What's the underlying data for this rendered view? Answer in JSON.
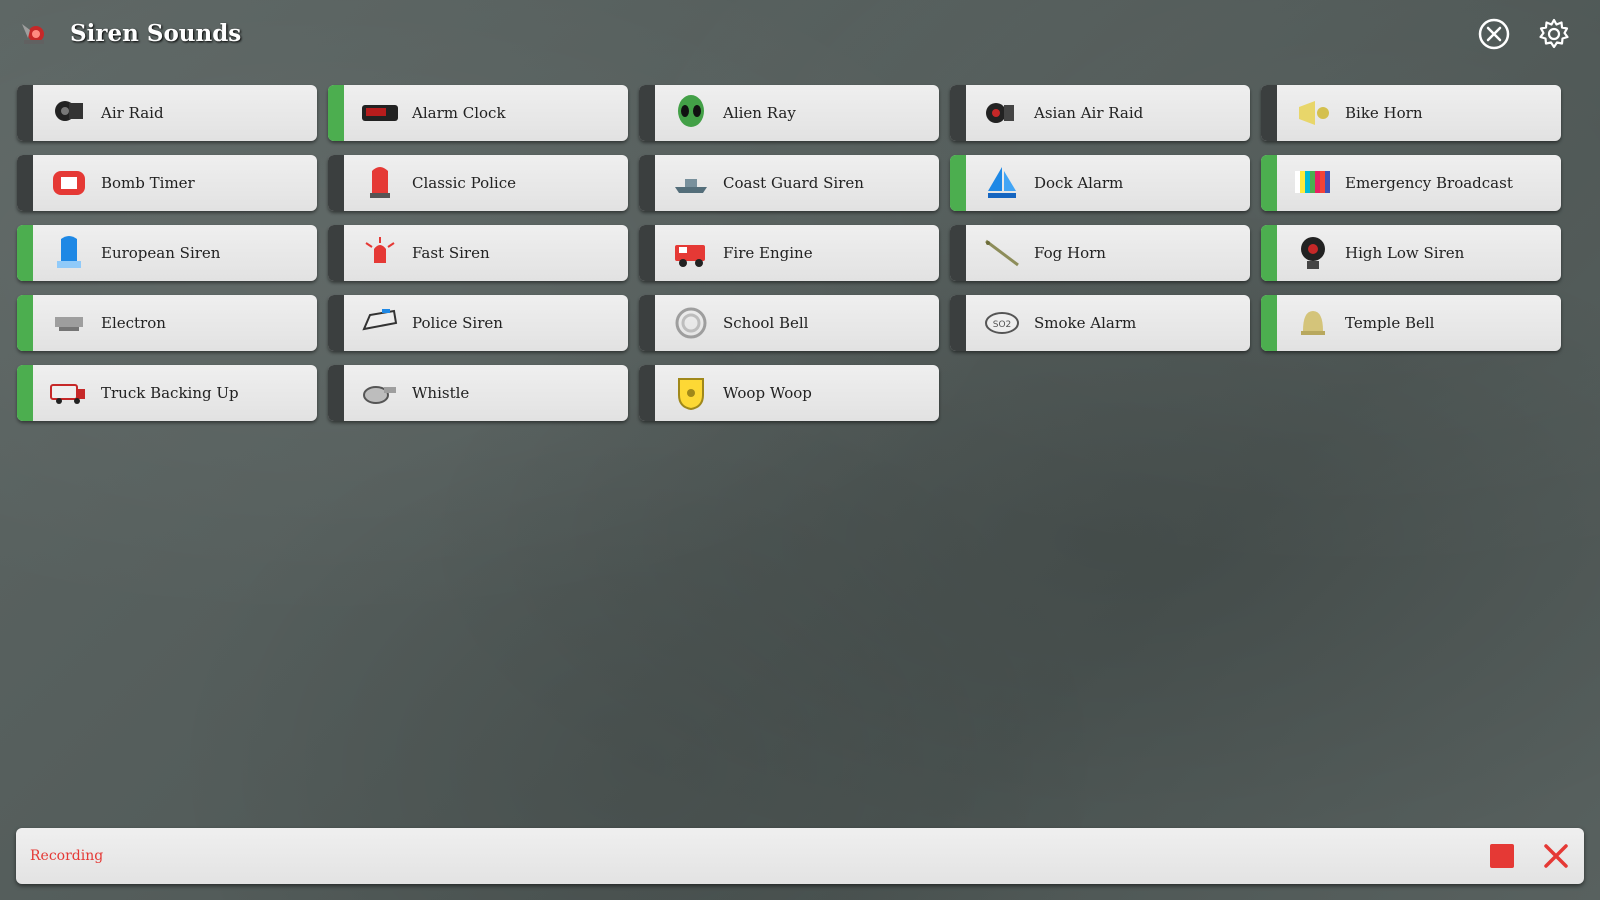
{
  "app": {
    "title": "Siren Sounds"
  },
  "header": {
    "close_icon": "close-circle-icon",
    "settings_icon": "gear-icon"
  },
  "colors": {
    "active_stripe": "#4cae4f",
    "inactive_stripe": "#3b3f3f",
    "recording": "#e53935"
  },
  "sounds": [
    {
      "label": "Air Raid",
      "icon": "air-raid-siren-icon",
      "active": false
    },
    {
      "label": "Alarm Clock",
      "icon": "alarm-clock-icon",
      "active": true
    },
    {
      "label": "Alien Ray",
      "icon": "alien-icon",
      "active": false
    },
    {
      "label": "Asian Air Raid",
      "icon": "asian-air-raid-siren-icon",
      "active": false
    },
    {
      "label": "Bike Horn",
      "icon": "bike-horn-icon",
      "active": false
    },
    {
      "label": "Bomb Timer",
      "icon": "bomb-timer-icon",
      "active": false
    },
    {
      "label": "Classic Police",
      "icon": "police-light-icon",
      "active": false
    },
    {
      "label": "Coast Guard Siren",
      "icon": "boat-icon",
      "active": false
    },
    {
      "label": "Dock Alarm",
      "icon": "sailboat-icon",
      "active": true
    },
    {
      "label": "Emergency Broadcast",
      "icon": "color-bars-icon",
      "active": true
    },
    {
      "label": "European Siren",
      "icon": "blue-light-icon",
      "active": true
    },
    {
      "label": "Fast Siren",
      "icon": "red-flashing-light-icon",
      "active": false
    },
    {
      "label": "Fire Engine",
      "icon": "fire-truck-icon",
      "active": false
    },
    {
      "label": "Fog Horn",
      "icon": "fog-horn-icon",
      "active": false
    },
    {
      "label": "High Low Siren",
      "icon": "speaker-siren-icon",
      "active": true
    },
    {
      "label": "Electron",
      "icon": "electron-device-icon",
      "active": true
    },
    {
      "label": "Police Siren",
      "icon": "police-car-icon",
      "active": false
    },
    {
      "label": "School Bell",
      "icon": "school-bell-icon",
      "active": false
    },
    {
      "label": "Smoke Alarm",
      "icon": "smoke-detector-icon",
      "active": false
    },
    {
      "label": "Temple Bell",
      "icon": "temple-bell-icon",
      "active": true
    },
    {
      "label": "Truck Backing Up",
      "icon": "truck-icon",
      "active": true
    },
    {
      "label": "Whistle",
      "icon": "whistle-icon",
      "active": false
    },
    {
      "label": "Woop Woop",
      "icon": "badge-icon",
      "active": false
    }
  ],
  "footer": {
    "status": "Recording",
    "stop_icon": "stop-icon",
    "cancel_icon": "close-x-icon"
  }
}
